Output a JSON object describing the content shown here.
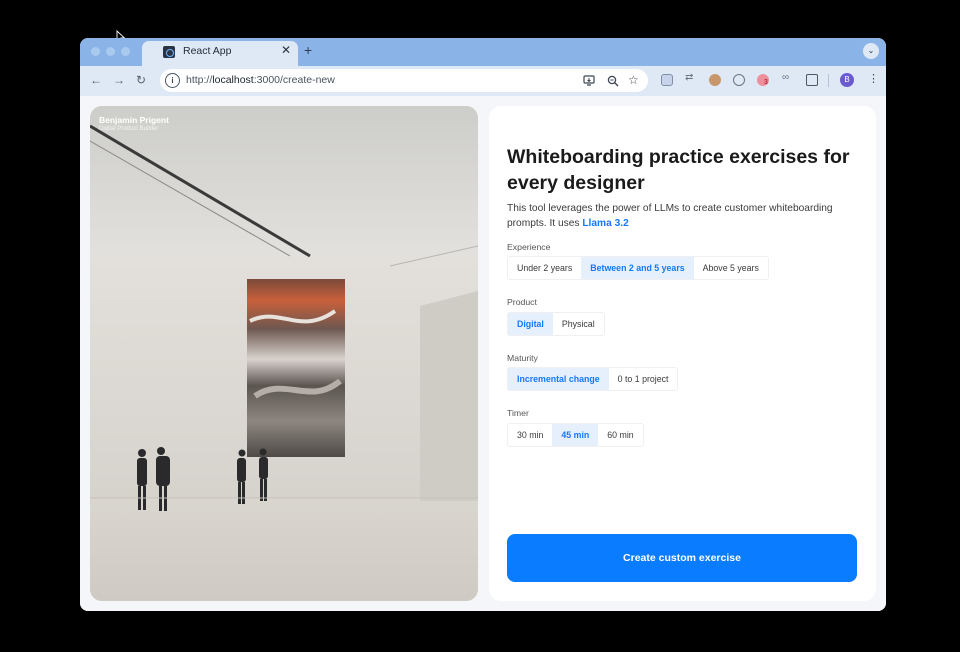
{
  "browser": {
    "tab_title": "React App",
    "tab_close": "✕",
    "new_tab": "+",
    "url_prefix": "http://",
    "url_host": "localhost",
    "url_path": ":3000/create-new",
    "profile_initial": "B",
    "extension_badge": "3"
  },
  "photo": {
    "author_name": "Benjamin Prigent",
    "author_role": "Digital Product Builder"
  },
  "panel": {
    "title": "Whiteboarding practice exercises for every designer",
    "description": "This tool leverages the power of LLMs to create customer whiteboarding prompts. It uses ",
    "model_link": "Llama 3.2"
  },
  "experience": {
    "label": "Experience",
    "options": [
      "Under 2 years",
      "Between 2 and 5 years",
      "Above 5 years"
    ],
    "selected": 1
  },
  "product": {
    "label": "Product",
    "options": [
      "Digital",
      "Physical"
    ],
    "selected": 0
  },
  "maturity": {
    "label": "Maturity",
    "options": [
      "Incremental change",
      "0 to 1 project"
    ],
    "selected": 0
  },
  "timer": {
    "label": "Timer",
    "options": [
      "30 min",
      "45 min",
      "60 min"
    ],
    "selected": 1
  },
  "cta": {
    "label": "Create custom exercise"
  },
  "colors": {
    "accent": "#0a7cff",
    "selected_bg": "#e6f0fd",
    "chrome": "#8ab4e8"
  }
}
